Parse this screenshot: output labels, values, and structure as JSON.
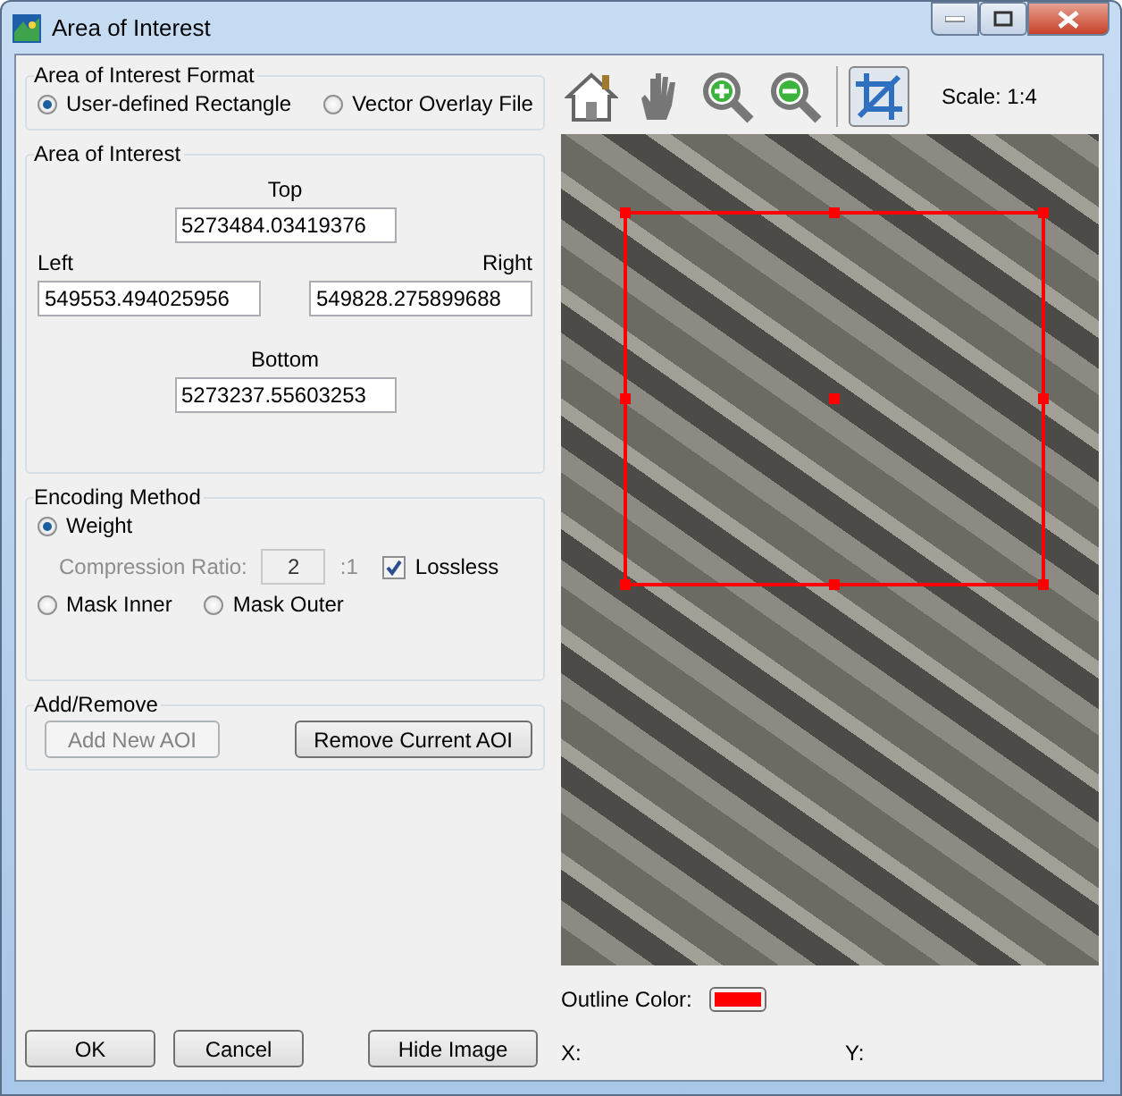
{
  "window": {
    "title": "Area of Interest"
  },
  "format": {
    "title": "Area of Interest Format",
    "options": [
      {
        "label": "User-defined Rectangle",
        "selected": true
      },
      {
        "label": "Vector Overlay File",
        "selected": false
      }
    ]
  },
  "area": {
    "title": "Area of Interest",
    "top": {
      "label": "Top",
      "value": "5273484.03419376"
    },
    "left": {
      "label": "Left",
      "value": "549553.494025956"
    },
    "right": {
      "label": "Right",
      "value": "549828.275899688"
    },
    "bottom": {
      "label": "Bottom",
      "value": "5273237.55603253"
    }
  },
  "encoding": {
    "title": "Encoding Method",
    "weight": {
      "label": "Weight",
      "selected": true
    },
    "compression": {
      "label": "Compression Ratio:",
      "value": "2",
      "suffix": ":1",
      "disabled": true
    },
    "lossless": {
      "label": "Lossless",
      "checked": true
    },
    "masks": [
      {
        "label": "Mask Inner",
        "selected": false
      },
      {
        "label": "Mask Outer",
        "selected": false
      }
    ]
  },
  "add_remove": {
    "title": "Add/Remove",
    "buttons": [
      {
        "label": "Add New AOI",
        "disabled": true
      },
      {
        "label": "Remove Current AOI",
        "disabled": false
      }
    ]
  },
  "toolbar": {
    "tools": [
      {
        "kind": "home",
        "selected": false
      },
      {
        "kind": "pan",
        "selected": false
      },
      {
        "kind": "zoom_in",
        "selected": false
      },
      {
        "kind": "zoom_out",
        "selected": false
      },
      {
        "kind": "crop",
        "selected": true
      }
    ],
    "scale": "Scale: 1:4"
  },
  "outline_color": {
    "label": "Outline Color:",
    "color": "#ff0000"
  },
  "coords": {
    "x": "X:",
    "y": "Y:"
  },
  "buttons": [
    "OK",
    "Cancel",
    "Hide Image"
  ]
}
